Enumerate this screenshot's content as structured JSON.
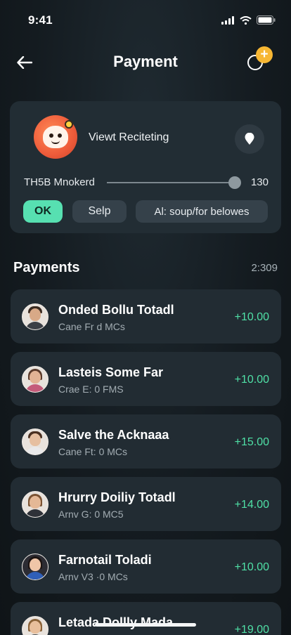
{
  "status": {
    "time": "9:41",
    "icons": [
      "signal-icon",
      "wifi-icon",
      "battery-icon"
    ]
  },
  "header": {
    "title": "Payment",
    "back_icon": "arrow-left-icon",
    "action_icon": "add-circle-icon"
  },
  "card": {
    "name": "Viewt Reciteting",
    "pin_icon": "location-pin-icon",
    "slider_label": "TH5B Mnokerd",
    "slider_value": "130",
    "slider_level": 0.97,
    "buttons": {
      "ok": "OK",
      "selp": "Selp",
      "all": "Al: soup/for belowes"
    }
  },
  "payments": {
    "title": "Payments",
    "meta": "2:309",
    "items": [
      {
        "title": "Onded Bollu Totadl",
        "subtitle": "Cane Fr d MCs",
        "amount": "+10.00"
      },
      {
        "title": "Lasteis Some Far",
        "subtitle": "Crae E: 0 FMS",
        "amount": "+10.00"
      },
      {
        "title": "Salve the Acknaaa",
        "subtitle": "Cane Ft: 0 MCs",
        "amount": "+15.00"
      },
      {
        "title": "Hrurry Doiliy Totadl",
        "subtitle": "Arnv G: 0 MC5",
        "amount": "+14.00"
      },
      {
        "title": "Farnotail Toladi",
        "subtitle": "Arnv V3 ·0 MCs",
        "amount": "+10.00"
      },
      {
        "title": "Letada Dollly Mada",
        "subtitle": "",
        "amount": "+19.00"
      }
    ]
  },
  "colors": {
    "accent": "#57e0b1",
    "amount": "#4fe0a6",
    "badge": "#f7b733",
    "card": "#222d34"
  }
}
